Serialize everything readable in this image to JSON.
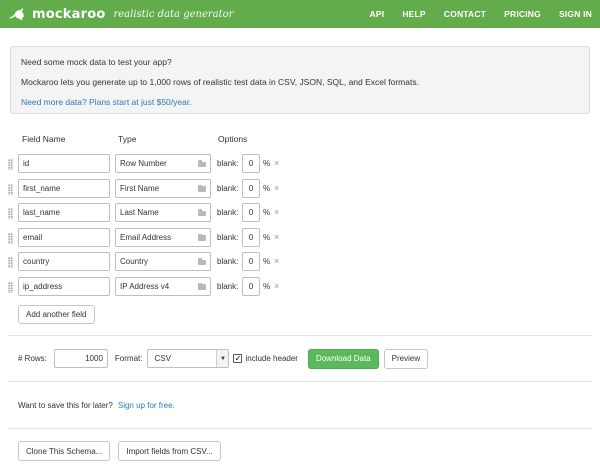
{
  "header": {
    "brand_name": "mockaroo",
    "tagline": "realistic data generator",
    "nav": [
      "API",
      "HELP",
      "CONTACT",
      "PRICING",
      "SIGN IN"
    ],
    "color": "#63ac4b"
  },
  "intro": {
    "line1": "Need some mock data to test your app?",
    "line2": "Mockaroo lets you generate up to 1,000 rows of realistic test data in CSV, JSON, SQL, and Excel formats.",
    "link": "Need more data? Plans start at just $50/year."
  },
  "columns": {
    "field_name": "Field Name",
    "type": "Type",
    "options": "Options"
  },
  "fields": [
    {
      "name": "id",
      "type": "Row Number",
      "blank": "0"
    },
    {
      "name": "first_name",
      "type": "First Name",
      "blank": "0"
    },
    {
      "name": "last_name",
      "type": "Last Name",
      "blank": "0"
    },
    {
      "name": "email",
      "type": "Email Address",
      "blank": "0"
    },
    {
      "name": "country",
      "type": "Country",
      "blank": "0"
    },
    {
      "name": "ip_address",
      "type": "IP Address v4",
      "blank": "0"
    }
  ],
  "labels": {
    "blank": "blank:",
    "percent": "%",
    "remove": "×",
    "add_field": "Add another field"
  },
  "options": {
    "rows_label": "# Rows:",
    "rows_value": "1000",
    "format_label": "Format:",
    "format_value": "CSV",
    "include_header_label": "include header",
    "include_header_checked": true,
    "download": "Download Data",
    "preview": "Preview"
  },
  "save": {
    "text": "Want to save this for later?",
    "link": "Sign up for free."
  },
  "bottom": {
    "clone": "Clone This Schema...",
    "import": "Import fields from CSV..."
  }
}
